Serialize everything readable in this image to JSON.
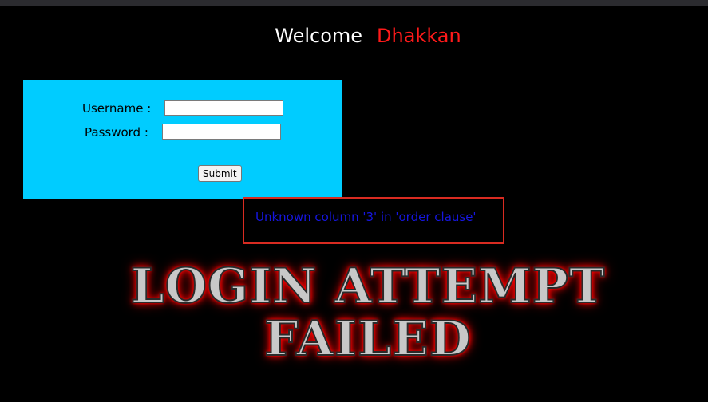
{
  "header": {
    "welcome": "Welcome",
    "name": "Dhakkan",
    "name_color": "#ff1a1a"
  },
  "login_form": {
    "panel_color": "#00ccff",
    "username_label": "Username :",
    "username_value": "",
    "password_label": "Password :",
    "password_value": "",
    "submit_label": "Submit"
  },
  "error": {
    "message": "Unknown column '3' in 'order clause'",
    "text_color": "#1616e0",
    "border_color": "#d82b21"
  },
  "banner": {
    "line1": "LOGIN ATTEMPT",
    "line2": "FAILED"
  }
}
